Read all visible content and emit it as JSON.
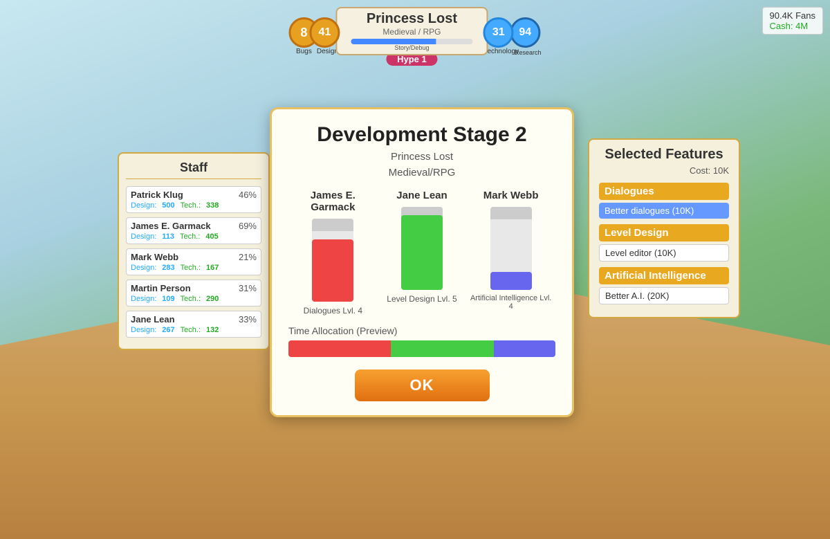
{
  "game": {
    "title": "Princess Lost",
    "genre": "Medieval / RPG"
  },
  "hud": {
    "bugs": "8",
    "bugs_label": "Bugs",
    "design_val": "41",
    "design_label": "Design",
    "story_label": "Story/Debug",
    "tech_val": "31",
    "tech_label": "Technology",
    "research_val": "94",
    "research_label": "Research",
    "hype": "Hype 1"
  },
  "top_right": {
    "fans": "90.4K Fans",
    "cash": "Cash: 4M"
  },
  "staff": {
    "title": "Staff",
    "members": [
      {
        "name": "Patrick Klug",
        "pct": "46%",
        "design_label": "Design:",
        "design_val": "500",
        "tech_label": "Tech.:",
        "tech_val": "338"
      },
      {
        "name": "James E. Garmack",
        "pct": "69%",
        "design_label": "Design:",
        "design_val": "113",
        "tech_label": "Tech.:",
        "tech_val": "405"
      },
      {
        "name": "Mark Webb",
        "pct": "21%",
        "design_label": "Design:",
        "design_val": "283",
        "tech_label": "Tech.:",
        "tech_val": "167"
      },
      {
        "name": "Martin Person",
        "pct": "31%",
        "design_label": "Design:",
        "design_val": "109",
        "tech_label": "Tech.:",
        "tech_val": "290"
      },
      {
        "name": "Jane Lean",
        "pct": "33%",
        "design_label": "Design:",
        "design_val": "267",
        "tech_label": "Tech.:",
        "tech_val": "132"
      }
    ]
  },
  "dev_modal": {
    "title": "Development Stage 2",
    "subtitle1": "Princess Lost",
    "subtitle2": "Medieval/RPG",
    "workers": [
      {
        "name": "James E. Garmack",
        "skill": "Dialogues Lvl. 4",
        "bar_color": "red"
      },
      {
        "name": "Jane Lean",
        "skill": "Level Design Lvl. 5",
        "bar_color": "green"
      },
      {
        "name": "Mark Webb",
        "skill": "Artificial Intelligence Lvl. 4",
        "bar_color": "blue"
      }
    ],
    "time_alloc_label": "Time Allocation (Preview)",
    "ok_label": "OK"
  },
  "features": {
    "title": "Selected Features",
    "cost": "Cost: 10K",
    "categories": [
      {
        "name": "Dialogues",
        "item": "Better dialogues (10K)",
        "item_highlighted": true
      },
      {
        "name": "Level Design",
        "item": "Level editor (10K)",
        "item_highlighted": false
      },
      {
        "name": "Artificial Intelligence",
        "item": "Better A.I. (20K)",
        "item_highlighted": false
      }
    ]
  }
}
